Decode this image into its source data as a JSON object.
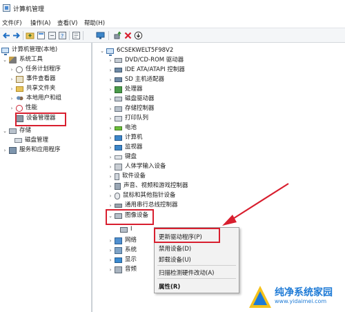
{
  "window": {
    "title": "计算机管理"
  },
  "menu": [
    "文件(F)",
    "操作(A)",
    "查看(V)",
    "帮助(H)"
  ],
  "toolbar": {
    "icons": [
      "back-arrow-icon",
      "forward-arrow-icon",
      "up-folder-icon",
      "properties-icon",
      "refresh-icon",
      "export-icon",
      "help-icon",
      "monitor-icon",
      "update-driver-icon",
      "delete-x-icon",
      "download-icon"
    ],
    "accent_delete": "#d81e2e",
    "accent_nav": "#1f6fc4"
  },
  "left_tree": {
    "root": "计算机管理(本地)",
    "system_tools": "系统工具",
    "task_scheduler": "任务计划程序",
    "event_viewer": "事件查看器",
    "shared_folders": "共享文件夹",
    "local_users": "本地用户和组",
    "performance": "性能",
    "device_manager": "设备管理器",
    "storage": "存储",
    "disk_management": "磁盘管理",
    "services_apps": "服务和应用程序"
  },
  "device_tree": {
    "computer_name": "6CSEKWELT5F98V2",
    "categories": [
      "DVD/CD-ROM 驱动器",
      "IDE ATA/ATAPI 控制器",
      "SD 主机适配器",
      "处理器",
      "磁盘驱动器",
      "存储控制器",
      "打印队列",
      "电池",
      "计算机",
      "监视器",
      "键盘",
      "人体学输入设备",
      "软件设备",
      "声音、视频和游戏控制器",
      "鼠标和其他指针设备",
      "通用串行总线控制器",
      "图像设备"
    ],
    "child_prefix": "I",
    "partial_items": [
      "网络",
      "系统",
      "显示",
      "音频"
    ]
  },
  "context_menu": {
    "items": [
      "更新驱动程序(P)",
      "禁用设备(D)",
      "卸载设备(U)",
      "扫描检测硬件改动(A)",
      "属性(R)"
    ]
  },
  "colors": {
    "highlight": "#d81e2e",
    "arrow": "#d81e2e",
    "watermark": "#1d7ad6"
  },
  "watermark": {
    "brand": "纯净系统家园",
    "url": "www.yidaimei.com"
  }
}
